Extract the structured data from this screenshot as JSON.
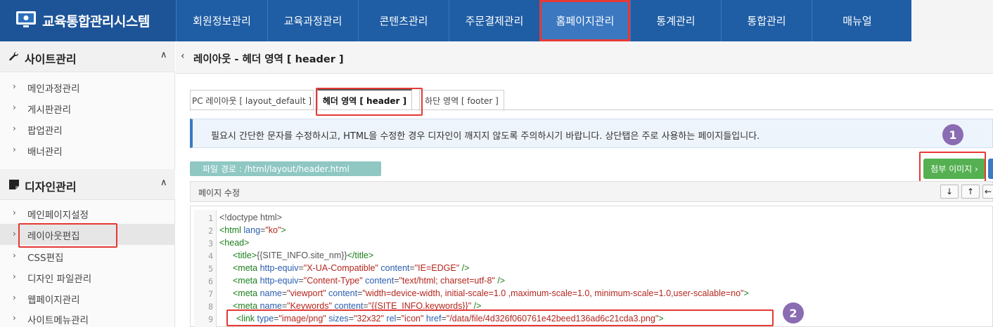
{
  "app": {
    "title": "교육통합관리시스템",
    "colors": {
      "topbar": "#1f5da4",
      "accent_red": "#e53935",
      "green_button": "#55b052",
      "badge": "#8a6cb3"
    }
  },
  "nav": {
    "items": [
      "회원정보관리",
      "교육과정관리",
      "콘텐츠관리",
      "주문결제관리",
      "홈페이지관리",
      "통계관리",
      "통합관리",
      "매뉴얼"
    ],
    "active": "홈페이지관리"
  },
  "sidebar": {
    "sections": [
      {
        "label": "사이트관리",
        "icon": "wrench-icon",
        "items": [
          "메인과정관리",
          "게시판관리",
          "팝업관리",
          "배너관리"
        ]
      },
      {
        "label": "디자인관리",
        "icon": "note-icon",
        "items": [
          "메인페이지설정",
          "레이아웃편집",
          "CSS편집",
          "디자인 파일관리",
          "웹페이지관리",
          "사이트메뉴관리"
        ]
      }
    ],
    "active_item": "레이아웃편집"
  },
  "main": {
    "title": "레이아웃 - 헤더 영역 [ header ]",
    "tabs": [
      "PC 레이아웃 [ layout_default ]",
      "헤더 영역 [ header ]",
      "하단 영역 [ footer ]"
    ],
    "active_tab": "헤더 영역 [ header ]",
    "notice": "필요시 간단한 문자를 수정하시고, HTML을 수정한 경우 디자인이 깨지지 않도록 주의하시기 바랍니다. 상단탭은 주로 사용하는 페이지들입니다.",
    "file_path": "파일 경로 : /html/layout/header.html",
    "attach_button": "첨부 이미지 ›",
    "edit_label": "페이지 수정",
    "editor_buttons": [
      "↓",
      "↑",
      "←"
    ],
    "badges": [
      "1",
      "2"
    ]
  },
  "code_lines": {
    "numbers": [
      "1",
      "2",
      "3",
      "4",
      "5",
      "6",
      "7",
      "8",
      "9"
    ],
    "l1": {
      "t1": "<!doctype html>"
    },
    "l2": {
      "t1": "<html ",
      "a1": "lang",
      "e1": "=",
      "s1": "\"ko\"",
      "t2": ">"
    },
    "l3": {
      "t1": "<head>"
    },
    "l4": {
      "t1": "<title>",
      "x1": "{{SITE_INFO.site_nm}}",
      "t2": "</title>"
    },
    "l5": {
      "t1": "<meta ",
      "a1": "http-equiv",
      "e1": "=",
      "s1": "\"X-UA-Compatible\"",
      "a2": " content",
      "e2": "=",
      "s2": "\"IE=EDGE\"",
      "t2": " />"
    },
    "l6": {
      "t1": "<meta ",
      "a1": "http-equiv",
      "e1": "=",
      "s1": "\"Content-Type\"",
      "a2": " content",
      "e2": "=",
      "s2": "\"text/html; charset=utf-8\"",
      "t2": " />"
    },
    "l7": {
      "t1": "<meta ",
      "a1": "name",
      "e1": "=",
      "s1": "\"viewport\"",
      "a2": " content",
      "e2": "=",
      "s2": "\"width=device-width, initial-scale=1.0 ,maximum-scale=1.0, minimum-scale=1.0,user-scalable=no\"",
      "t2": ">"
    },
    "l8": {
      "t1": "<meta ",
      "a1": "name",
      "e1": "=",
      "s1": "\"Keywords\"",
      "a2": " content",
      "e2": "=",
      "s2": "\"{{SITE_INFO.keywords}}\"",
      "t2": " />"
    },
    "l9": {
      "t1": "<link ",
      "a1": "type",
      "e1": "=",
      "s1": "\"image/png\"",
      "a2": " sizes",
      "e2": "=",
      "s2": "\"32x32\"",
      "a3": " rel",
      "e3": "=",
      "s3": "\"icon\"",
      "a4": " href",
      "e4": "=",
      "s4": "\"/data/file/4d326f060761e42beed136ad6c21cda3.png\"",
      "t2": ">"
    }
  }
}
